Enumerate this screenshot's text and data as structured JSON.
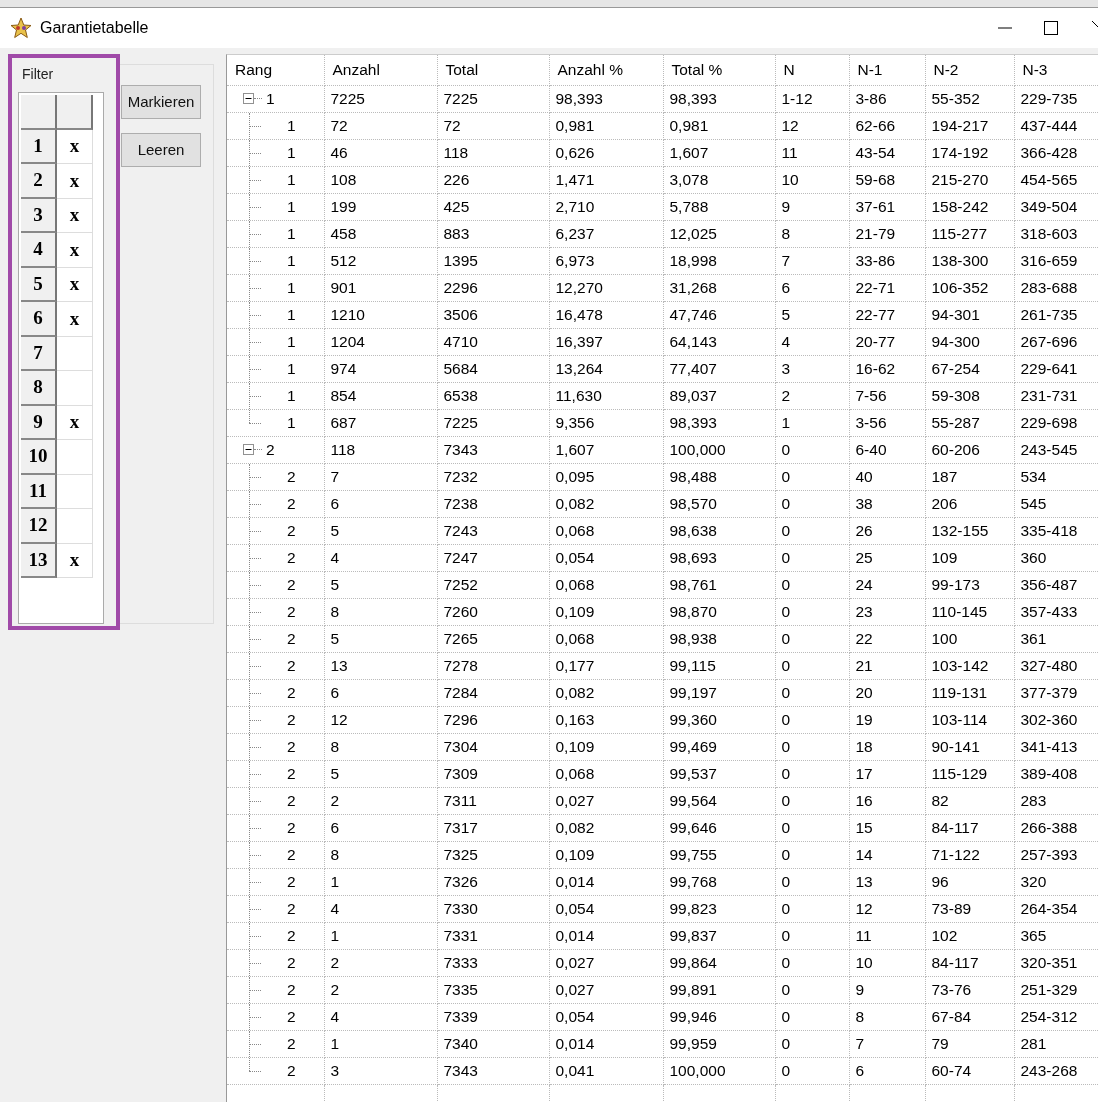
{
  "window": {
    "title": "Garantietabelle"
  },
  "filter": {
    "title": "Filter",
    "rows": [
      {
        "label": "1",
        "mark": "x"
      },
      {
        "label": "2",
        "mark": "x"
      },
      {
        "label": "3",
        "mark": "x"
      },
      {
        "label": "4",
        "mark": "x"
      },
      {
        "label": "5",
        "mark": "x"
      },
      {
        "label": "6",
        "mark": "x"
      },
      {
        "label": "7"
      },
      {
        "label": "8"
      },
      {
        "label": "9",
        "mark": "x"
      },
      {
        "label": "10"
      },
      {
        "label": "11"
      },
      {
        "label": "12"
      },
      {
        "label": "13",
        "mark": "x"
      }
    ]
  },
  "buttons": [
    "Markieren",
    "Leeren"
  ],
  "tree": {
    "columns": [
      "Rang",
      "Anzahl",
      "Total",
      "Anzahl %",
      "Total %",
      "N",
      "N-1",
      "N-2",
      "N-3"
    ],
    "rows": [
      {
        "cells": [
          "1",
          "7225",
          "7225",
          "98,393",
          "98,393",
          "1-12",
          "3-86",
          "55-352",
          "229-735"
        ],
        "expanded": true,
        "children": [
          {
            "cells": [
              "1",
              "72",
              "72",
              "0,981",
              "0,981",
              "12",
              "62-66",
              "194-217",
              "437-444"
            ]
          },
          {
            "cells": [
              "1",
              "46",
              "118",
              "0,626",
              "1,607",
              "11",
              "43-54",
              "174-192",
              "366-428"
            ]
          },
          {
            "cells": [
              "1",
              "108",
              "226",
              "1,471",
              "3,078",
              "10",
              "59-68",
              "215-270",
              "454-565"
            ]
          },
          {
            "cells": [
              "1",
              "199",
              "425",
              "2,710",
              "5,788",
              "9",
              "37-61",
              "158-242",
              "349-504"
            ]
          },
          {
            "cells": [
              "1",
              "458",
              "883",
              "6,237",
              "12,025",
              "8",
              "21-79",
              "115-277",
              "318-603"
            ]
          },
          {
            "cells": [
              "1",
              "512",
              "1395",
              "6,973",
              "18,998",
              "7",
              "33-86",
              "138-300",
              "316-659"
            ]
          },
          {
            "cells": [
              "1",
              "901",
              "2296",
              "12,270",
              "31,268",
              "6",
              "22-71",
              "106-352",
              "283-688"
            ]
          },
          {
            "cells": [
              "1",
              "1210",
              "3506",
              "16,478",
              "47,746",
              "5",
              "22-77",
              "94-301",
              "261-735"
            ]
          },
          {
            "cells": [
              "1",
              "1204",
              "4710",
              "16,397",
              "64,143",
              "4",
              "20-77",
              "94-300",
              "267-696"
            ]
          },
          {
            "cells": [
              "1",
              "974",
              "5684",
              "13,264",
              "77,407",
              "3",
              "16-62",
              "67-254",
              "229-641"
            ]
          },
          {
            "cells": [
              "1",
              "854",
              "6538",
              "11,630",
              "89,037",
              "2",
              "7-56",
              "59-308",
              "231-731"
            ]
          },
          {
            "cells": [
              "1",
              "687",
              "7225",
              "9,356",
              "98,393",
              "1",
              "3-56",
              "55-287",
              "229-698"
            ]
          }
        ]
      },
      {
        "cells": [
          "2",
          "118",
          "7343",
          "1,607",
          "100,000",
          "0",
          "6-40",
          "60-206",
          "243-545"
        ],
        "expanded": true,
        "children": [
          {
            "cells": [
              "2",
              "7",
              "7232",
              "0,095",
              "98,488",
              "0",
              "40",
              "187",
              "534"
            ]
          },
          {
            "cells": [
              "2",
              "6",
              "7238",
              "0,082",
              "98,570",
              "0",
              "38",
              "206",
              "545"
            ]
          },
          {
            "cells": [
              "2",
              "5",
              "7243",
              "0,068",
              "98,638",
              "0",
              "26",
              "132-155",
              "335-418"
            ]
          },
          {
            "cells": [
              "2",
              "4",
              "7247",
              "0,054",
              "98,693",
              "0",
              "25",
              "109",
              "360"
            ]
          },
          {
            "cells": [
              "2",
              "5",
              "7252",
              "0,068",
              "98,761",
              "0",
              "24",
              "99-173",
              "356-487"
            ]
          },
          {
            "cells": [
              "2",
              "8",
              "7260",
              "0,109",
              "98,870",
              "0",
              "23",
              "110-145",
              "357-433"
            ]
          },
          {
            "cells": [
              "2",
              "5",
              "7265",
              "0,068",
              "98,938",
              "0",
              "22",
              "100",
              "361"
            ]
          },
          {
            "cells": [
              "2",
              "13",
              "7278",
              "0,177",
              "99,115",
              "0",
              "21",
              "103-142",
              "327-480"
            ]
          },
          {
            "cells": [
              "2",
              "6",
              "7284",
              "0,082",
              "99,197",
              "0",
              "20",
              "119-131",
              "377-379"
            ]
          },
          {
            "cells": [
              "2",
              "12",
              "7296",
              "0,163",
              "99,360",
              "0",
              "19",
              "103-114",
              "302-360"
            ]
          },
          {
            "cells": [
              "2",
              "8",
              "7304",
              "0,109",
              "99,469",
              "0",
              "18",
              "90-141",
              "341-413"
            ]
          },
          {
            "cells": [
              "2",
              "5",
              "7309",
              "0,068",
              "99,537",
              "0",
              "17",
              "115-129",
              "389-408"
            ]
          },
          {
            "cells": [
              "2",
              "2",
              "7311",
              "0,027",
              "99,564",
              "0",
              "16",
              "82",
              "283"
            ]
          },
          {
            "cells": [
              "2",
              "6",
              "7317",
              "0,082",
              "99,646",
              "0",
              "15",
              "84-117",
              "266-388"
            ]
          },
          {
            "cells": [
              "2",
              "8",
              "7325",
              "0,109",
              "99,755",
              "0",
              "14",
              "71-122",
              "257-393"
            ]
          },
          {
            "cells": [
              "2",
              "1",
              "7326",
              "0,014",
              "99,768",
              "0",
              "13",
              "96",
              "320"
            ]
          },
          {
            "cells": [
              "2",
              "4",
              "7330",
              "0,054",
              "99,823",
              "0",
              "12",
              "73-89",
              "264-354"
            ]
          },
          {
            "cells": [
              "2",
              "1",
              "7331",
              "0,014",
              "99,837",
              "0",
              "11",
              "102",
              "365"
            ]
          },
          {
            "cells": [
              "2",
              "2",
              "7333",
              "0,027",
              "99,864",
              "0",
              "10",
              "84-117",
              "320-351"
            ]
          },
          {
            "cells": [
              "2",
              "2",
              "7335",
              "0,027",
              "99,891",
              "0",
              "9",
              "73-76",
              "251-329"
            ]
          },
          {
            "cells": [
              "2",
              "4",
              "7339",
              "0,054",
              "99,946",
              "0",
              "8",
              "67-84",
              "254-312"
            ]
          },
          {
            "cells": [
              "2",
              "1",
              "7340",
              "0,014",
              "99,959",
              "0",
              "7",
              "79",
              "281"
            ]
          },
          {
            "cells": [
              "2",
              "3",
              "7343",
              "0,041",
              "100,000",
              "0",
              "6",
              "60-74",
              "243-268"
            ]
          }
        ]
      }
    ]
  }
}
